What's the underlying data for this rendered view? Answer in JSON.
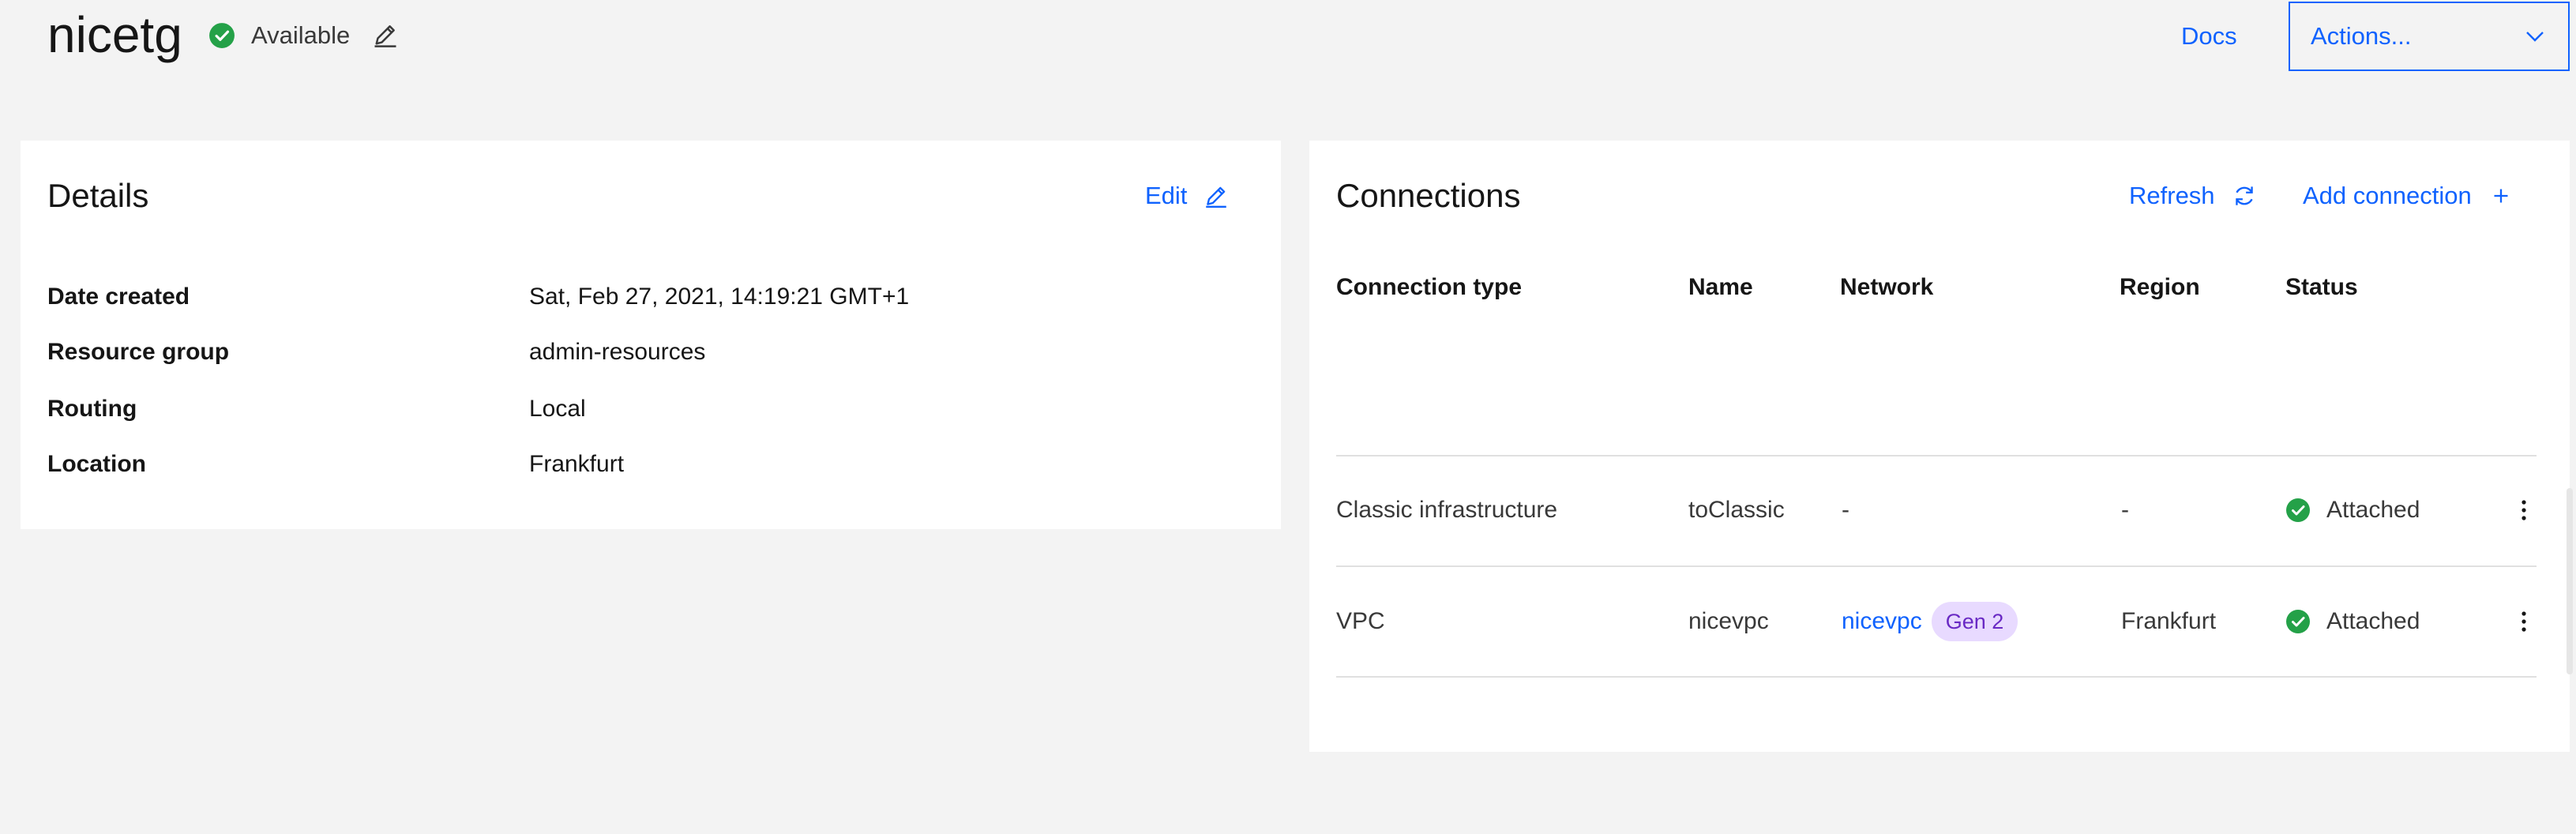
{
  "header": {
    "title": "nicetg",
    "status": "Available",
    "docs_label": "Docs",
    "actions_label": "Actions..."
  },
  "details": {
    "title": "Details",
    "edit_label": "Edit",
    "fields": [
      {
        "key": "Date created",
        "value": "Sat, Feb 27, 2021, 14:19:21 GMT+1"
      },
      {
        "key": "Resource group",
        "value": "admin-resources"
      },
      {
        "key": "Routing",
        "value": "Local"
      },
      {
        "key": "Location",
        "value": "Frankfurt"
      }
    ]
  },
  "connections": {
    "title": "Connections",
    "refresh_label": "Refresh",
    "add_label": "Add connection",
    "columns": [
      "Connection type",
      "Name",
      "Network",
      "Region",
      "Status"
    ],
    "rows": [
      {
        "type": "Classic infrastructure",
        "name": "toClassic",
        "network": "-",
        "network_tag": "",
        "region": "-",
        "status": "Attached"
      },
      {
        "type": "VPC",
        "name": "nicevpc",
        "network": "nicevpc",
        "network_tag": "Gen 2",
        "region": "Frankfurt",
        "status": "Attached"
      }
    ]
  },
  "colors": {
    "link": "#0f62fe",
    "success": "#24a148",
    "tag_bg": "#e8daff",
    "tag_text": "#6929c4"
  },
  "icons": [
    "checkmark-filled-icon",
    "edit-icon",
    "chevron-down-icon",
    "refresh-icon",
    "add-icon",
    "overflow-menu-icon"
  ]
}
